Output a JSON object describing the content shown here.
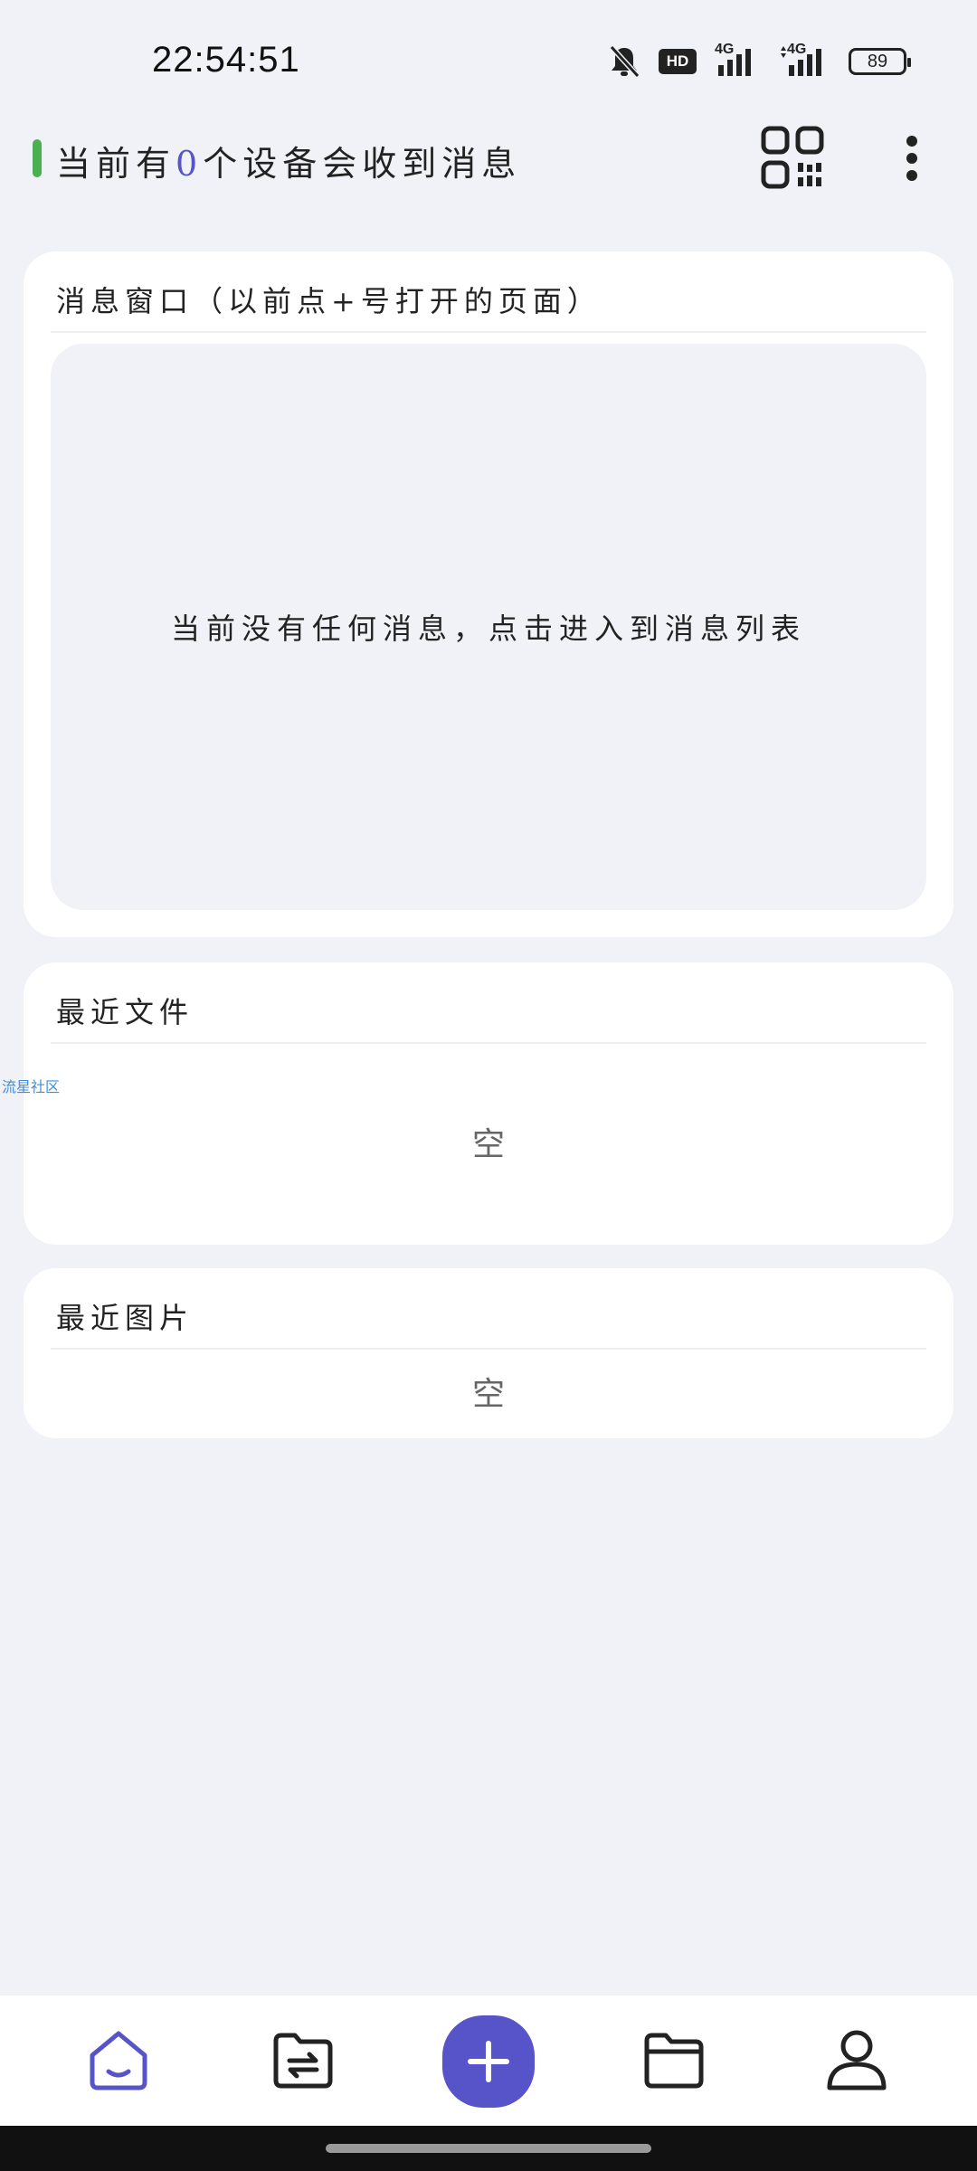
{
  "status_bar": {
    "time": "22:54:51",
    "icons": [
      "bell-off-icon",
      "hd-icon",
      "signal-4g-icon",
      "signal-4g-icon"
    ],
    "hd_label": "HD",
    "network_label_1": "4G",
    "network_label_2": "4G",
    "battery_level": "89"
  },
  "header": {
    "title_prefix": "当前有",
    "device_count": "0",
    "title_suffix": "个设备会收到消息",
    "accent_color": "#5654c8",
    "indicator_color": "#4caf50",
    "qr_icon": "qr-code-icon",
    "more_icon": "more-vertical-icon"
  },
  "message_card": {
    "title": "消息窗口（以前点+号打开的页面）",
    "empty_text": "当前没有任何消息，点击进入到消息列表"
  },
  "recent_files": {
    "title": "最近文件",
    "empty_text": "空"
  },
  "recent_images": {
    "title": "最近图片",
    "empty_text": "空"
  },
  "watermark": "流星社区",
  "bottom_nav": {
    "items": [
      {
        "icon": "home-icon",
        "active": true
      },
      {
        "icon": "folder-transfer-icon",
        "active": false
      },
      {
        "icon": "plus-icon",
        "active": false
      },
      {
        "icon": "folder-icon",
        "active": false
      },
      {
        "icon": "user-icon",
        "active": false
      }
    ],
    "active_color": "#5654c8"
  }
}
